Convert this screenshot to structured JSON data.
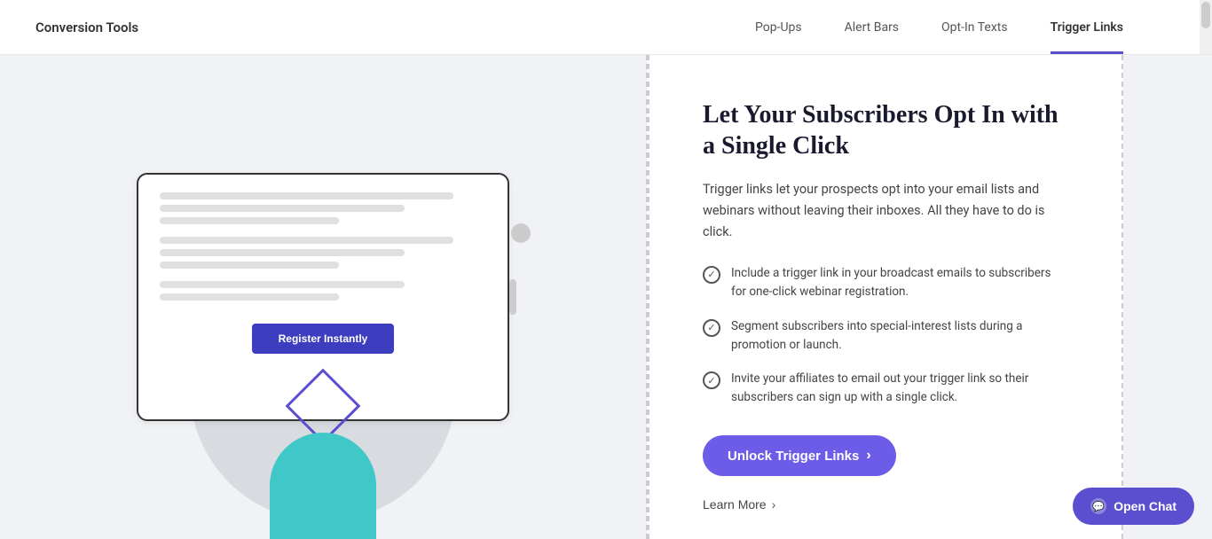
{
  "header": {
    "brand": "Conversion Tools",
    "nav": [
      {
        "id": "pop-ups",
        "label": "Pop-Ups",
        "active": false
      },
      {
        "id": "alert-bars",
        "label": "Alert Bars",
        "active": false
      },
      {
        "id": "opt-in-texts",
        "label": "Opt-In Texts",
        "active": false
      },
      {
        "id": "trigger-links",
        "label": "Trigger Links",
        "active": true
      }
    ]
  },
  "content": {
    "title": "Let Your Subscribers Opt In with a Single Click",
    "description": "Trigger links let your prospects opt into your email lists and webinars without leaving their inboxes. All they have to do is click.",
    "features": [
      {
        "id": "feature-1",
        "text": "Include a trigger link in your broadcast emails to subscribers for one-click webinar registration."
      },
      {
        "id": "feature-2",
        "text": "Segment subscribers into special-interest lists during a promotion or launch."
      },
      {
        "id": "feature-3",
        "text": "Invite your affiliates to email out your trigger link so their subscribers can sign up with a single click."
      }
    ],
    "unlock_button": "Unlock Trigger Links",
    "learn_more": "Learn More"
  },
  "illustration": {
    "tablet_button_label": "Register Instantly"
  },
  "chat": {
    "button_label": "Open Chat"
  }
}
